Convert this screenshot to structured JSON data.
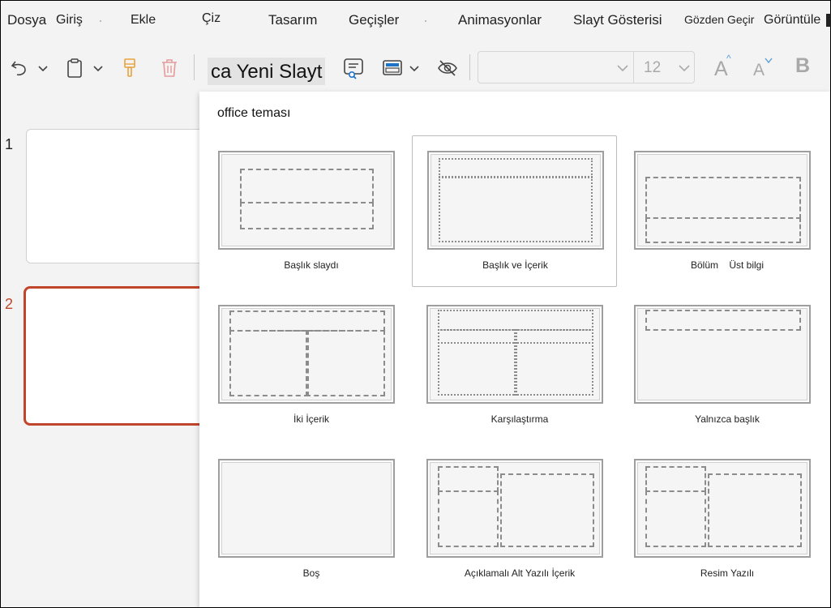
{
  "menu": {
    "items": [
      {
        "label": "Dosya"
      },
      {
        "label": "Giriş"
      },
      {
        "label": "Ekle"
      },
      {
        "label": "Çiz"
      },
      {
        "label": "Tasarım"
      },
      {
        "label": "Geçişler"
      },
      {
        "label": "Animasyonlar"
      },
      {
        "label": "Slayt Gösterisi"
      },
      {
        "label": "Gözden Geçir"
      },
      {
        "label": "Görüntüle"
      }
    ]
  },
  "toolbar": {
    "new_slide_label": "ca Yeni Slayt",
    "font_size": "12",
    "grow_font": "A",
    "shrink_font": "A",
    "bold": "B",
    "icons": [
      "undo-icon",
      "chevron-down-icon",
      "clipboard-icon",
      "format-painter-icon",
      "delete-icon",
      "reuse-slides-icon",
      "layout-icon",
      "hide-slide-icon"
    ]
  },
  "thumbnails": [
    {
      "number": "1"
    },
    {
      "number": "2"
    }
  ],
  "gallery": {
    "title": "office teması",
    "layouts": [
      {
        "name": "Başlık slaydı"
      },
      {
        "name": "Başlık ve İçerik"
      },
      {
        "name": "Bölüm    Üst bilgi"
      },
      {
        "name": "İki İçerik"
      },
      {
        "name": "Karşılaştırma"
      },
      {
        "name": "Yalnızca başlık"
      },
      {
        "name": "Boş"
      },
      {
        "name": "Açıklamalı Alt Yazılı İçerik"
      },
      {
        "name": "Resim Yazılı"
      }
    ]
  },
  "colors": {
    "accent_selected_slide": "#c0452b",
    "format_painter": "#e8a13a",
    "delete_icon": "#e49a9a",
    "reuse_icon": "#1e73c9"
  }
}
